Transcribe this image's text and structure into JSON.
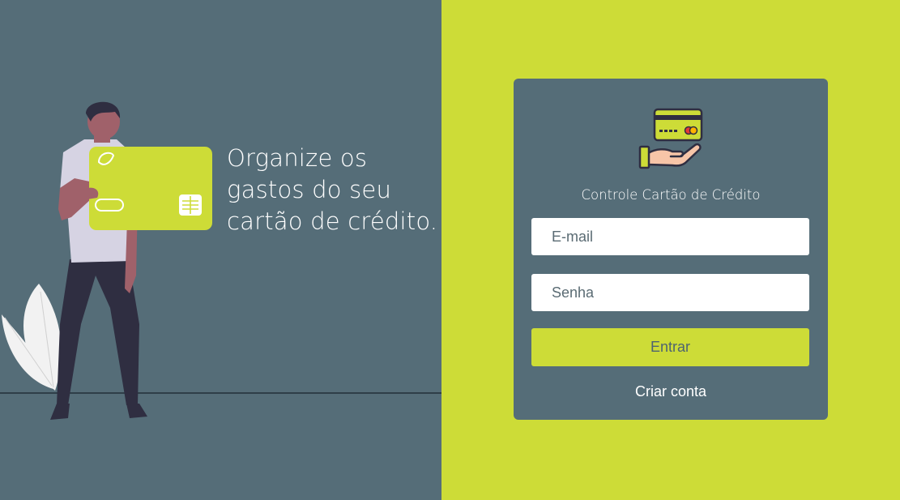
{
  "hero": {
    "tagline_lines": [
      "Organize os",
      "gastos do seu",
      "cartão de crédito."
    ]
  },
  "login": {
    "title": "Controle Cartão de Crédito",
    "email_placeholder": "E-mail",
    "password_placeholder": "Senha",
    "submit_label": "Entrar",
    "create_account_label": "Criar conta"
  },
  "colors": {
    "left_background": "#556d78",
    "right_background": "#cddc37",
    "card_background": "#556d78",
    "accent": "#cddc37"
  },
  "icons": {
    "logo": "credit-card-hand-icon"
  }
}
